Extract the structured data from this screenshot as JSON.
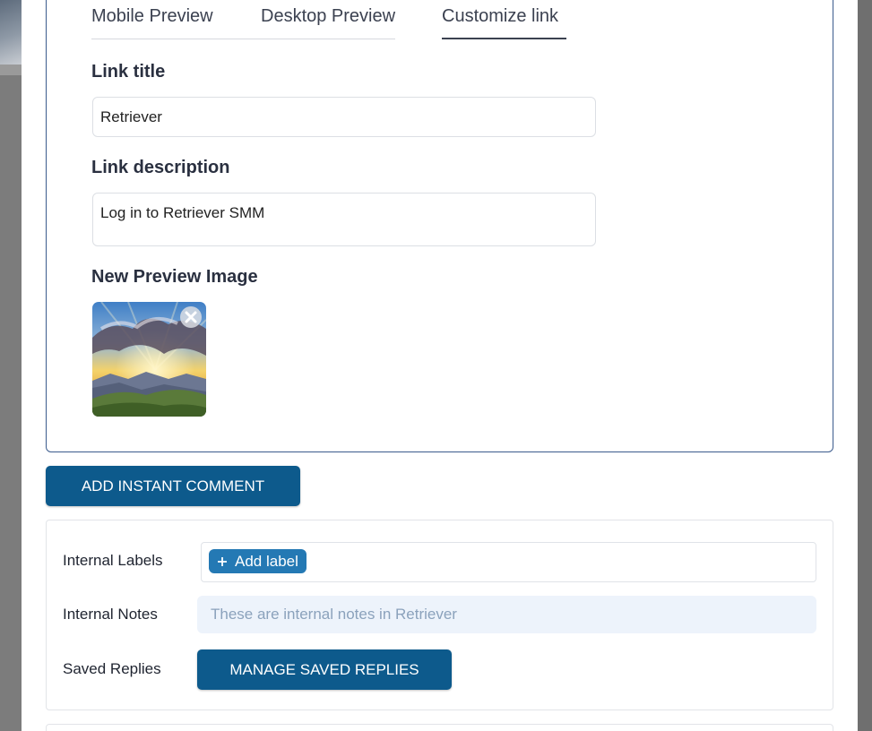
{
  "tabs": [
    {
      "label": "Mobile Preview"
    },
    {
      "label": "Desktop Preview"
    },
    {
      "label": "Customize link",
      "active": true
    }
  ],
  "link_title": {
    "label": "Link title",
    "value": "Retriever"
  },
  "link_description": {
    "label": "Link description",
    "value": "Log in to Retriever SMM"
  },
  "preview_image": {
    "label": "New Preview Image",
    "icon": "close-icon"
  },
  "add_instant_comment": {
    "label": "ADD INSTANT COMMENT"
  },
  "settings": {
    "internal_labels": {
      "label": "Internal Labels",
      "add_label": "Add label",
      "icon": "plus-icon"
    },
    "internal_notes": {
      "label": "Internal Notes",
      "placeholder": "These are internal notes in Retriever"
    },
    "saved_replies": {
      "label": "Saved Replies",
      "button": "MANAGE SAVED REPLIES"
    }
  },
  "colors": {
    "primary_button": "#0d5a8c",
    "chip": "#2479b4",
    "card_border": "#3b5b8d",
    "notes_bg": "#edf3fb"
  }
}
